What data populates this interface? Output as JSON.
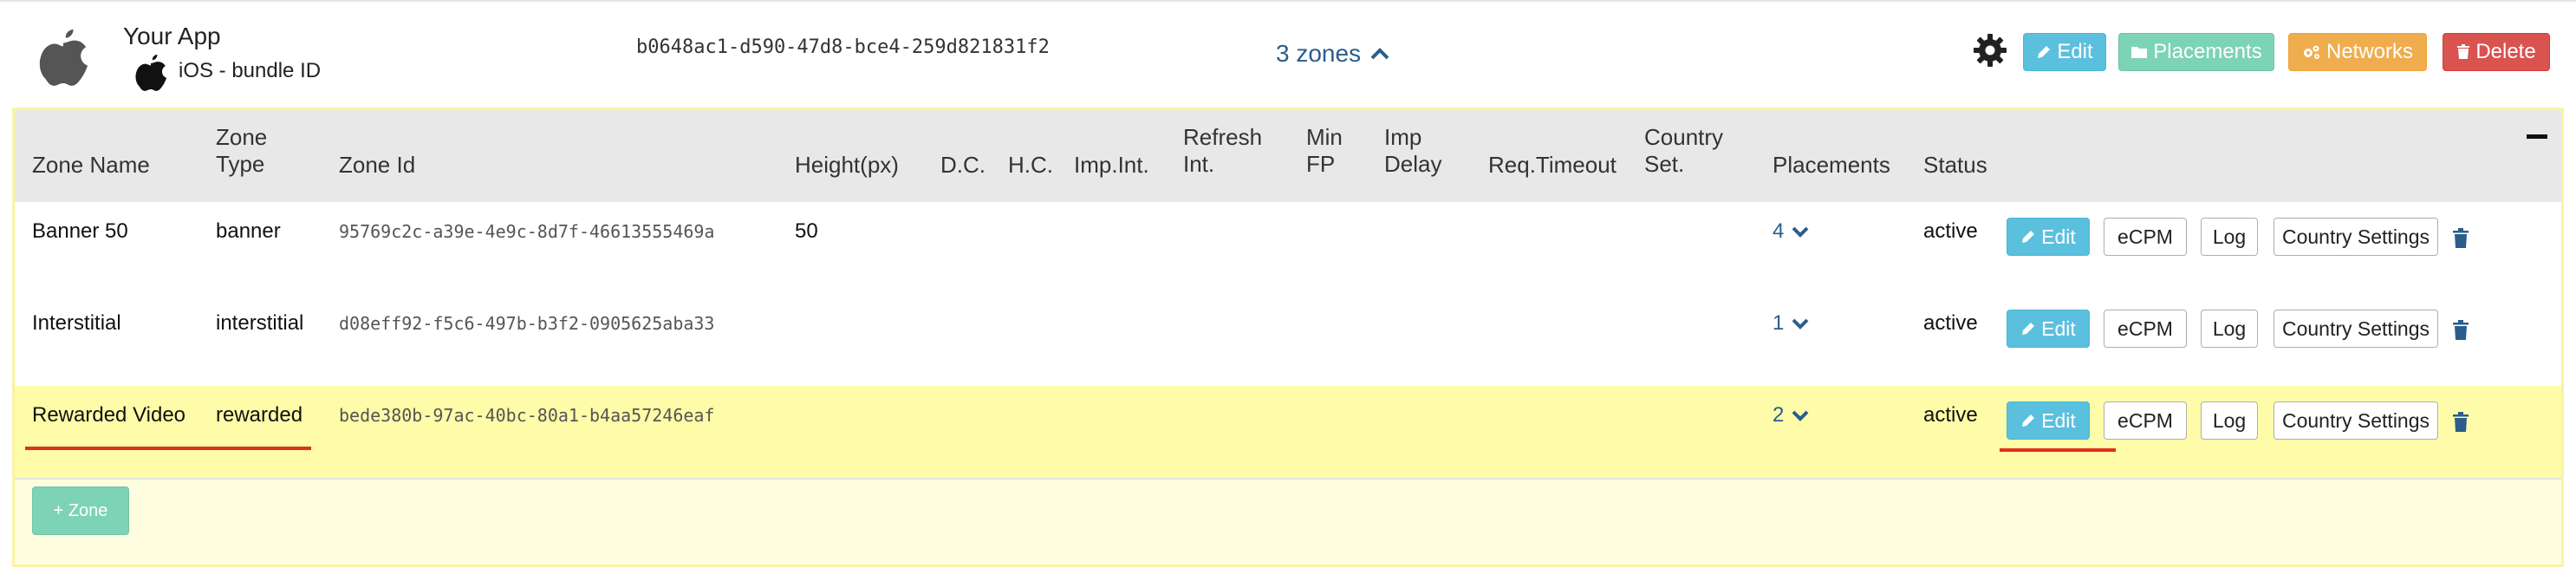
{
  "app": {
    "name": "Your App",
    "platform": "iOS - bundle ID",
    "uuid": "b0648ac1-d590-47d8-bce4-259d821831f2",
    "zones_toggle": "3 zones",
    "buttons": {
      "edit": "Edit",
      "placements": "Placements",
      "networks": "Networks",
      "delete": "Delete"
    }
  },
  "table": {
    "headers": {
      "zone_name": "Zone Name",
      "zone_type_1": "Zone",
      "zone_type_2": "Type",
      "zone_id": "Zone Id",
      "height": "Height(px)",
      "dc": "D.C.",
      "hc": "H.C.",
      "imp_int": "Imp.Int.",
      "refresh_1": "Refresh",
      "refresh_2": "Int.",
      "min_fp_1": "Min",
      "min_fp_2": "FP",
      "imp_delay_1": "Imp",
      "imp_delay_2": "Delay",
      "req_timeout": "Req.Timeout",
      "country_set_1": "Country",
      "country_set_2": "Set.",
      "placements": "Placements",
      "status": "Status"
    },
    "rows": [
      {
        "name": "Banner 50",
        "type": "banner",
        "id": "95769c2c-a39e-4e9c-8d7f-46613555469a",
        "height": "50",
        "placements": "4",
        "status": "active"
      },
      {
        "name": "Interstitial",
        "type": "interstitial",
        "id": "d08eff92-f5c6-497b-b3f2-0905625aba33",
        "height": "",
        "placements": "1",
        "status": "active"
      },
      {
        "name": "Rewarded Video",
        "type": "rewarded",
        "id": "bede380b-97ac-40bc-80a1-b4aa57246eaf",
        "height": "",
        "placements": "2",
        "status": "active"
      }
    ],
    "row_actions": {
      "edit": "Edit",
      "ecpm": "eCPM",
      "log": "Log",
      "country_settings": "Country Settings"
    }
  },
  "add_zone": "+ Zone",
  "colors": {
    "info": "#5bc0de",
    "teal": "#7dd3b5",
    "warning": "#f0ad4e",
    "danger": "#d9534f",
    "highlight_row": "#fefca8",
    "annotation": "#e0301e"
  }
}
